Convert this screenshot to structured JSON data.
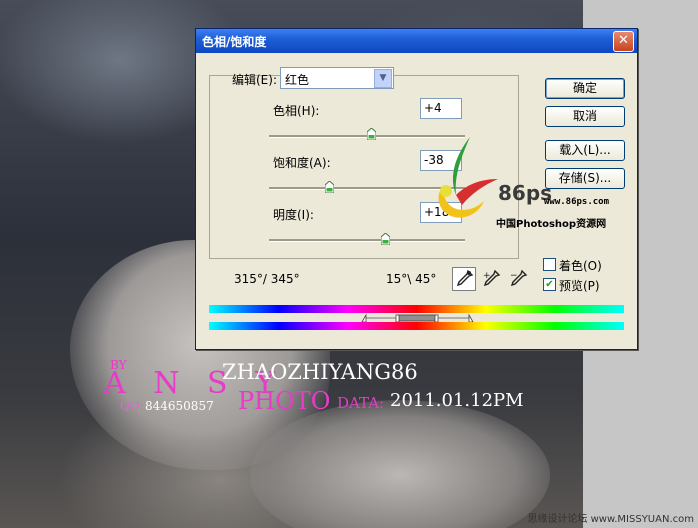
{
  "photo": {
    "by": "BY",
    "name": "A N S Y",
    "qq_label": "QQ:",
    "qq_number": "844650857",
    "author": "ZHAOZHIYANG86",
    "photo_word": "PHOTO",
    "data_word": "DATA:",
    "date": "2011.01.12PM",
    "watermark": "思缘设计论坛 www.MISSYUAN.com"
  },
  "dialog": {
    "title": "色相/饱和度",
    "close_glyph": "✕",
    "edit_label": "编辑(E):",
    "edit_value": "红色",
    "hue_label": "色相(H):",
    "hue_value": "+4",
    "sat_label": "饱和度(A):",
    "sat_value": "-38",
    "light_label": "明度(I):",
    "light_value": "+18",
    "range_left": "315°/ 345°",
    "range_right": "15°\\ 45°",
    "buttons": {
      "ok": "确定",
      "cancel": "取消",
      "load": "载入(L)...",
      "save": "存储(S)..."
    },
    "colorize_label": "着色(O)",
    "colorize_checked": false,
    "preview_label": "预览(P)",
    "preview_checked": true,
    "slider_levels": {
      "hue": 4,
      "saturation": -38,
      "lightness": 18
    }
  },
  "logo": {
    "text": "86ps",
    "url": "www.86ps.com",
    "cn": "中国Photoshop资源网"
  },
  "icons": [
    "eyedropper-icon",
    "eyedropper-plus-icon",
    "eyedropper-minus-icon",
    "close-icon",
    "dropdown-arrow-icon"
  ],
  "colors": {
    "accent_pink": "#e63cc8",
    "titlebar_blue": "#0d47c2"
  }
}
